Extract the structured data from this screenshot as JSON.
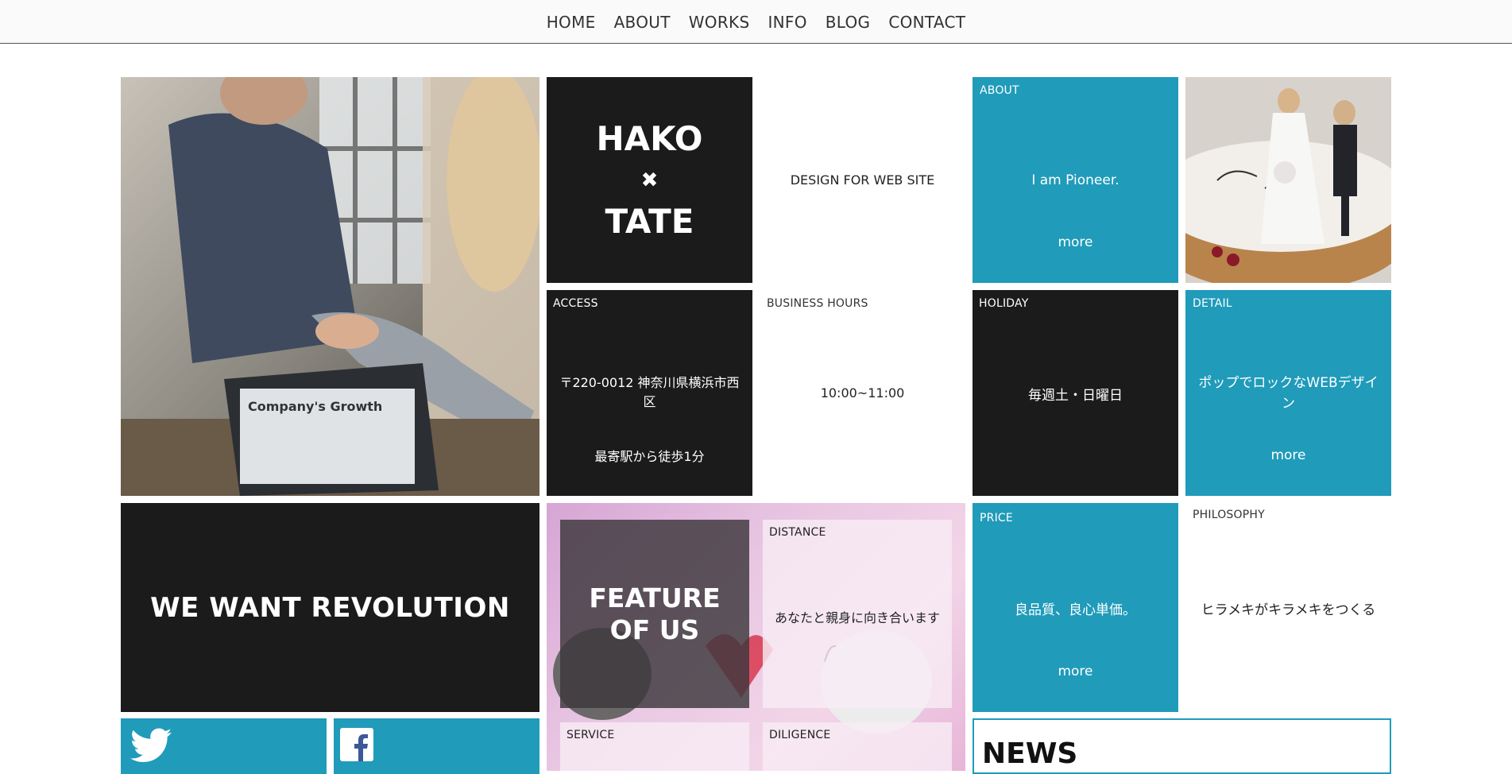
{
  "nav": {
    "items": [
      "HOME",
      "ABOUT",
      "WORKS",
      "INFO",
      "BLOG",
      "CONTACT"
    ]
  },
  "hero_tile": {
    "title_line1": "HAKO",
    "title_cross": "✖",
    "title_line2": "TATE"
  },
  "design_tile": {
    "text": "DESIGN FOR WEB SITE"
  },
  "about_tile": {
    "label": "ABOUT",
    "text": "I am Pioneer.",
    "more": "more"
  },
  "access_tile": {
    "label": "ACCESS",
    "address": "〒220-0012 神奈川県横浜市西区",
    "station": "最寄駅から徒歩1分"
  },
  "hours_tile": {
    "label": "BUSINESS HOURS",
    "text": "10:00~11:00"
  },
  "holiday_tile": {
    "label": "HOLIDAY",
    "text": "毎週土・日曜日"
  },
  "detail_tile": {
    "label": "DETAIL",
    "text": "ポップでロックなWEBデザイン",
    "more": "more"
  },
  "revolution_tile": {
    "text": "WE WANT REVOLUTION"
  },
  "feature_tile": {
    "title_line1": "FEATURE",
    "title_line2": "OF US",
    "distance_label": "DISTANCE",
    "distance_text": "あなたと親身に向き合います",
    "service_label": "SERVICE",
    "diligence_label": "DILIGENCE"
  },
  "price_tile": {
    "label": "PRICE",
    "text": "良品質、良心単価。",
    "more": "more"
  },
  "philosophy_tile": {
    "label": "PHILOSOPHY",
    "text": "ヒラメキがキラメキをつくる"
  },
  "news_tile": {
    "title": "NEWS"
  },
  "social": {
    "twitter_icon": "twitter-icon",
    "facebook_icon": "facebook-icon"
  },
  "colors": {
    "accent": "#209bba",
    "dark": "#1b1b1b"
  }
}
